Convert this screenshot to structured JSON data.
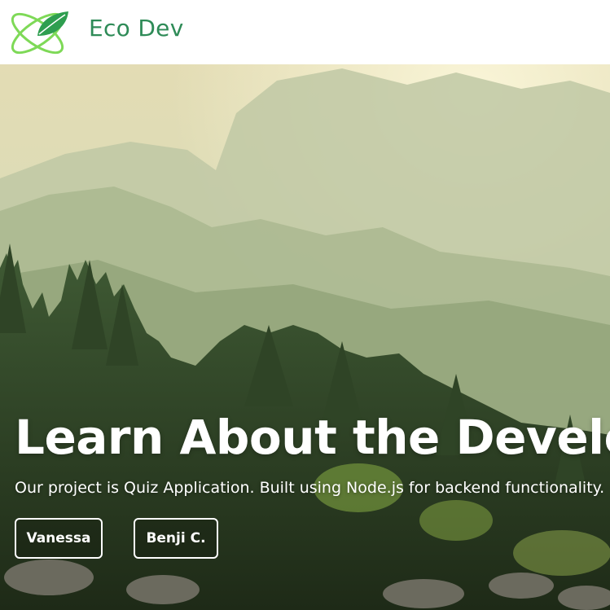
{
  "navbar": {
    "brand": "Eco Dev",
    "logo_icon": "leaf-orbit-icon",
    "brand_color": "#2e8b57"
  },
  "hero": {
    "title": "Learn About the Developers",
    "subtitle": "Our project is Quiz Application. Built using Node.js for backend functionality.",
    "buttons": [
      {
        "label": "Vanessa"
      },
      {
        "label": "Benji C."
      }
    ]
  }
}
